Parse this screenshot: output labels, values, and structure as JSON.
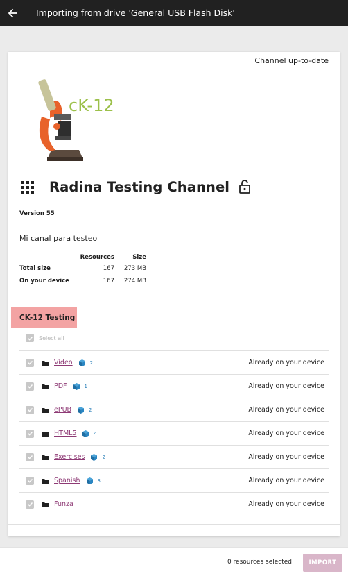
{
  "appbar": {
    "back_icon": "arrow-left-icon",
    "title": "Importing from drive 'General USB Flash Disk'"
  },
  "channel": {
    "status": "Channel up-to-date",
    "logo_text": "cK-12",
    "title": "Radina Testing Channel",
    "version": "Version 55",
    "description": "Mi canal para testeo",
    "size_table": {
      "headers": {
        "resources": "Resources",
        "size": "Size"
      },
      "rows": [
        {
          "label": "Total size",
          "resources": "167",
          "size": "273 MB"
        },
        {
          "label": "On your device",
          "resources": "167",
          "size": "274 MB"
        }
      ]
    }
  },
  "topic": {
    "name": "CK-12 Testing",
    "select_all": "Select all"
  },
  "items": [
    {
      "name": "Video",
      "count": "2",
      "status": "Already on your device",
      "has_count": true
    },
    {
      "name": "PDF",
      "count": "1",
      "status": "Already on your device",
      "has_count": true
    },
    {
      "name": "ePUB",
      "count": "2",
      "status": "Already on your device",
      "has_count": true
    },
    {
      "name": "HTML5",
      "count": "4",
      "status": "Already on your device",
      "has_count": true
    },
    {
      "name": "Exercises",
      "count": "2",
      "status": "Already on your device",
      "has_count": true
    },
    {
      "name": "Spanish",
      "count": "3",
      "status": "Already on your device",
      "has_count": true
    },
    {
      "name": "Funza",
      "count": "",
      "status": "Already on your device",
      "has_count": false
    }
  ],
  "footer": {
    "selected": "0 resources selected",
    "import_label": "IMPORT"
  },
  "colors": {
    "appbar": "#212121",
    "topic_highlight": "#f3a3a3",
    "link": "#8e3a75",
    "resource_icon": "#2a7fb8",
    "import_disabled": "#d9b6c9"
  }
}
